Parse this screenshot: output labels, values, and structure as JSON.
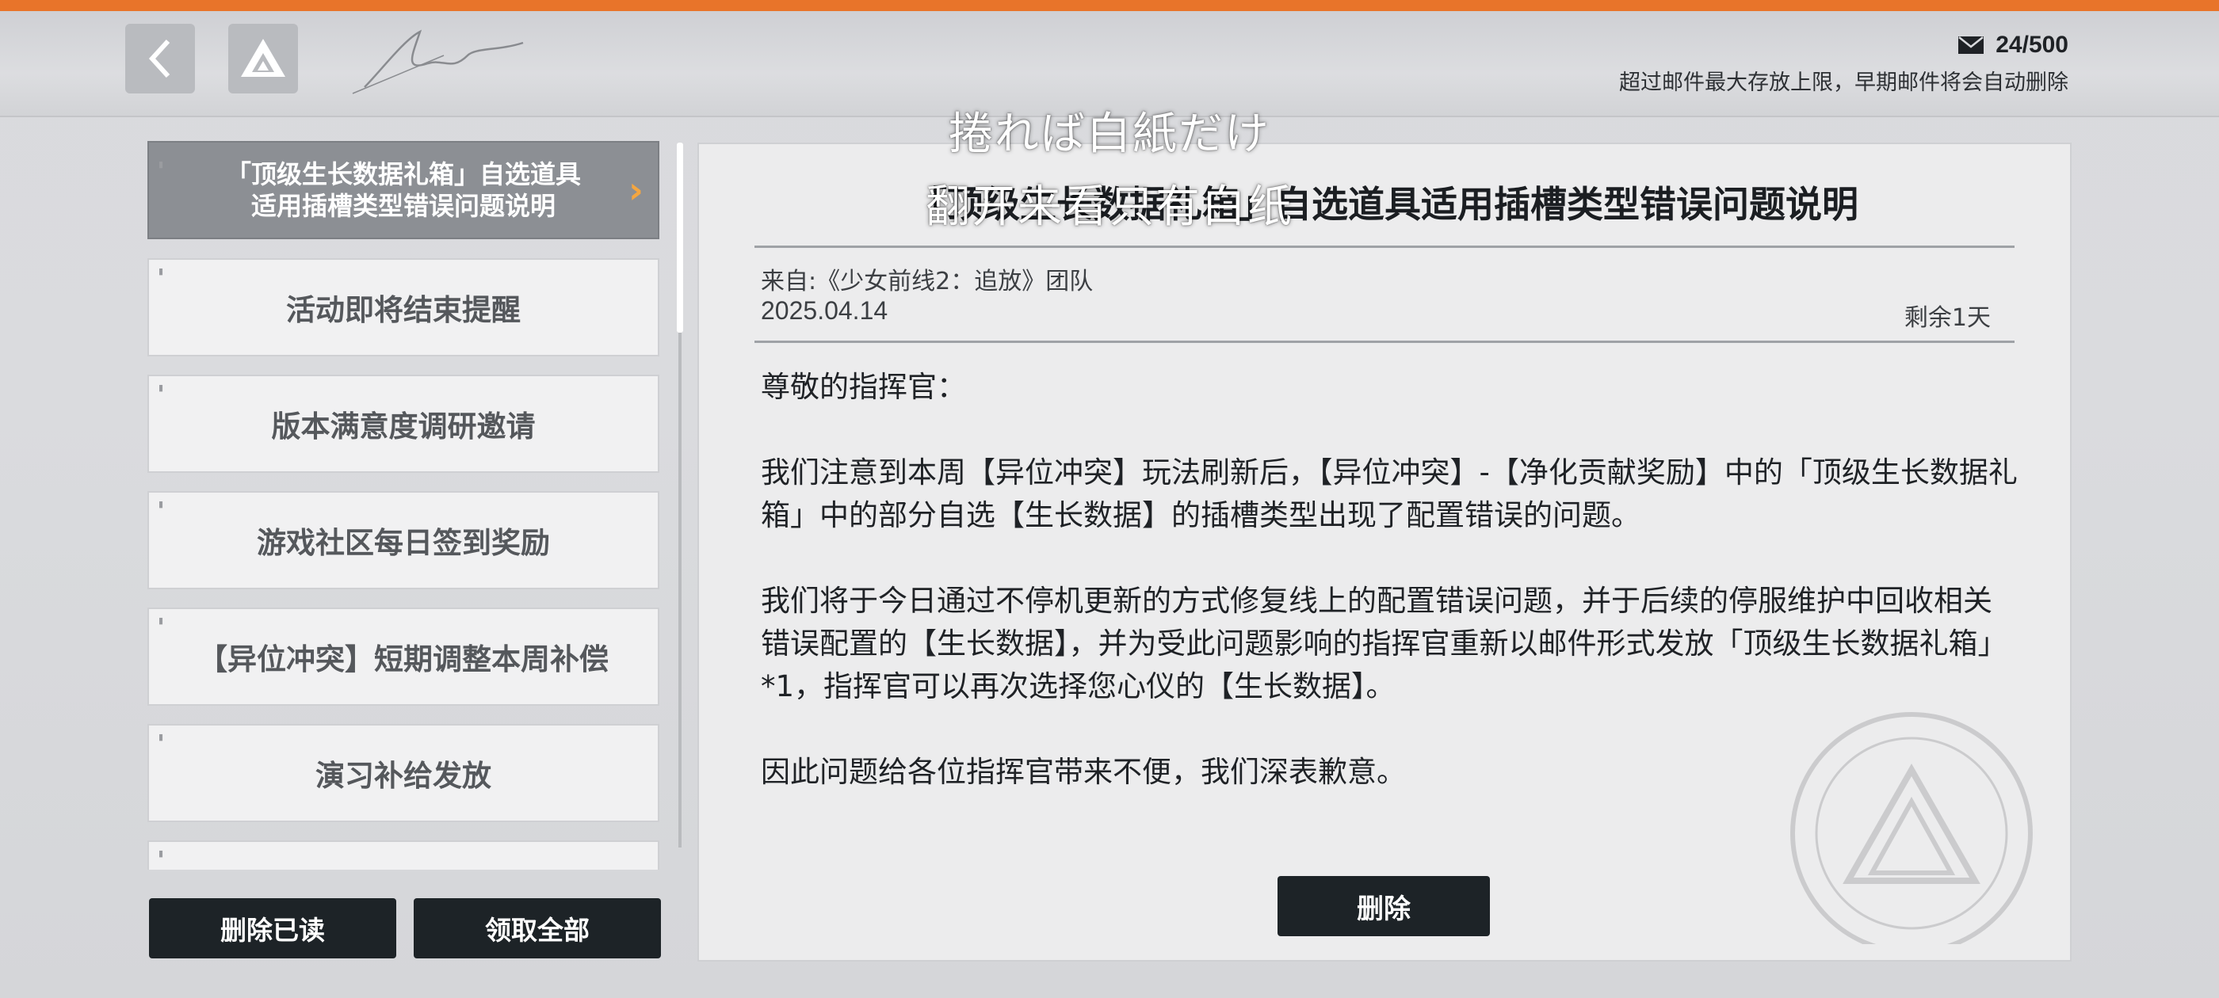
{
  "header": {
    "mail_count": "24/500",
    "mail_note": "超过邮件最大存放上限，早期邮件将会自动删除"
  },
  "subtitles": {
    "line1": "捲れば白紙だけ",
    "line2": "翻开来看只有白纸"
  },
  "mail_list": [
    {
      "line1": "「顶级生长数据礼箱」自选道具",
      "line2": "适用插槽类型错误问题说明",
      "active": true
    },
    {
      "label": "活动即将结束提醒"
    },
    {
      "label": "版本满意度调研邀请"
    },
    {
      "label": "游戏社区每日签到奖励"
    },
    {
      "label": "【异位冲突】短期调整本周补偿"
    },
    {
      "label": "演习补给发放"
    }
  ],
  "actions": {
    "delete_read": "删除已读",
    "claim_all": "领取全部",
    "delete": "删除"
  },
  "mail": {
    "title": "「顶级生长数据礼箱」自选道具适用插槽类型错误问题说明",
    "from": "来自:《少女前线2：追放》团队",
    "date": "2025.04.14",
    "remaining": "剩余1天",
    "greeting": "尊敬的指挥官：",
    "para1": "我们注意到本周【异位冲突】玩法刷新后，【异位冲突】-【净化贡献奖励】中的「顶级生长数据礼箱」中的部分自选【生长数据】的插槽类型出现了配置错误的问题。",
    "para2": "我们将于今日通过不停机更新的方式修复线上的配置错误问题，并于后续的停服维护中回收相关错误配置的【生长数据】，并为受此问题影响的指挥官重新以邮件形式发放「顶级生长数据礼箱」*1，指挥官可以再次选择您心仪的【生长数据】。",
    "para3": "因此问题给各位指挥官带来不便，我们深表歉意。"
  },
  "colors": {
    "accent": "#e8742a",
    "arrow": "#f4a640",
    "button": "#1d2327"
  }
}
